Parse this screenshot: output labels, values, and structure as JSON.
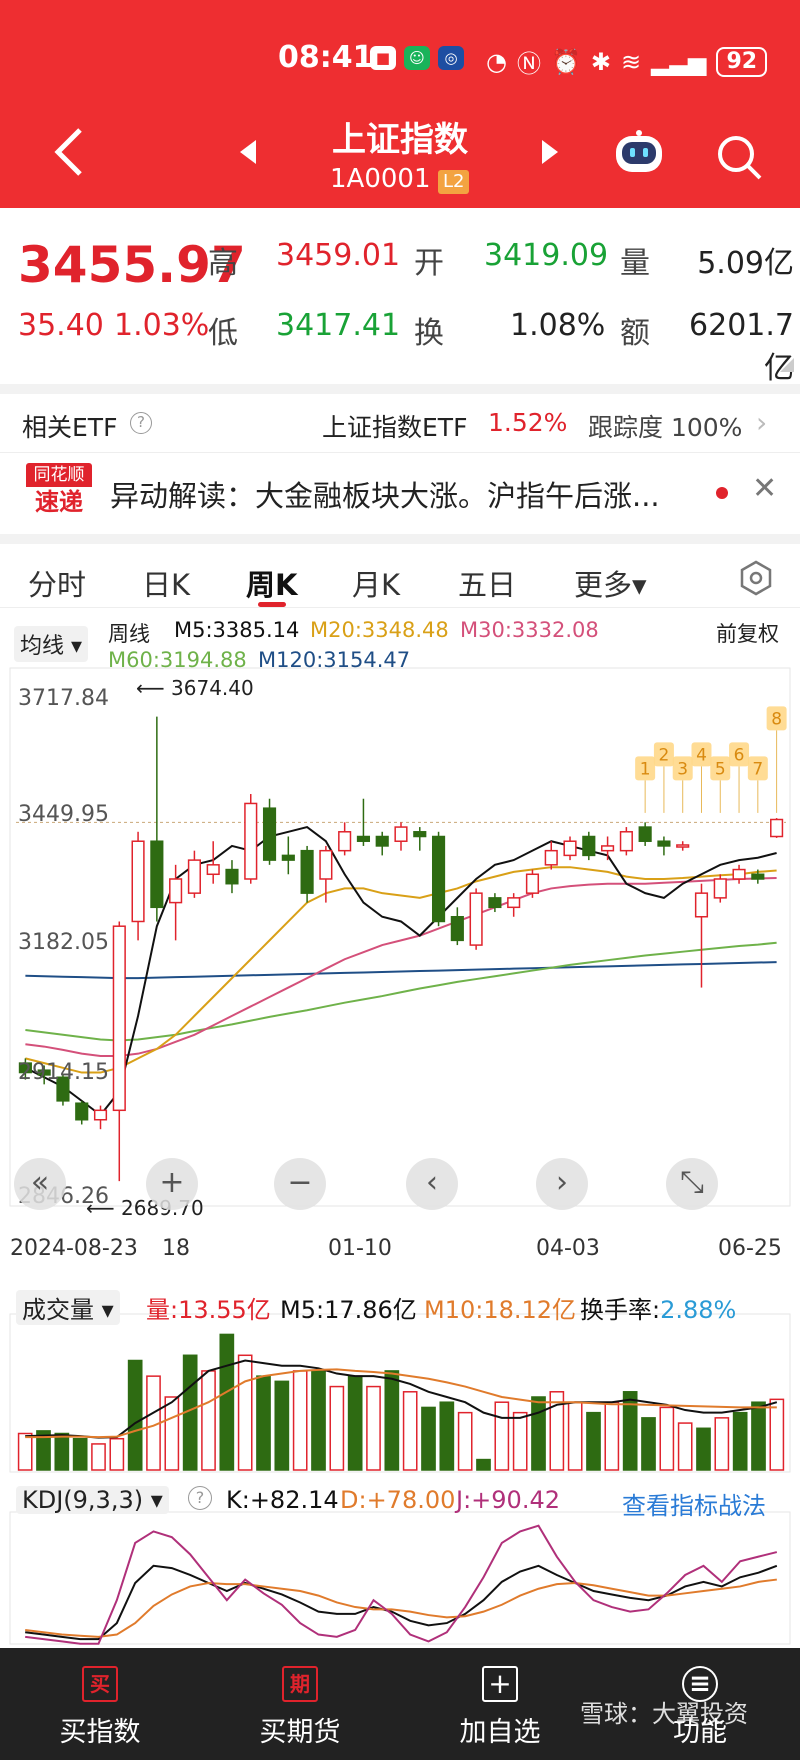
{
  "status_bar": {
    "time": "08:41",
    "battery": "92"
  },
  "header": {
    "title": "上证指数",
    "code": "1A0001",
    "level_badge": "L2"
  },
  "quote": {
    "price": "3455.97",
    "change": "35.40",
    "change_pct": "1.03%",
    "high_label": "高",
    "high": "3459.01",
    "open_label": "开",
    "open": "3419.09",
    "volume_label": "量",
    "volume": "5.09亿",
    "low_label": "低",
    "low": "3417.41",
    "turnover_label": "换",
    "turnover": "1.08%",
    "amount_label": "额",
    "amount": "6201.7亿"
  },
  "etf": {
    "label": "相关ETF",
    "name": "上证指数ETF",
    "pct": "1.52%",
    "track": "跟踪度 100%"
  },
  "news": {
    "logo_top": "同花顺",
    "logo_bottom": "速递",
    "text": "异动解读：大金融板块大涨。沪指午后涨..."
  },
  "tabs": [
    {
      "label": "分时"
    },
    {
      "label": "日K"
    },
    {
      "label": "周K"
    },
    {
      "label": "月K"
    },
    {
      "label": "五日"
    },
    {
      "label": "更多▾"
    }
  ],
  "ma_legend": {
    "chip": "均线 ▾",
    "period": "周线",
    "adjust": "前复权",
    "m5": "M5:3385.14",
    "m20": "M20:3348.48",
    "m30": "M30:3332.08",
    "m60": "M60:3194.88",
    "m120": "M120:3154.47"
  },
  "colors": {
    "up": "#e0232c",
    "down": "#2e6b12",
    "m5": "#111111",
    "m20": "#d9a017",
    "m30": "#d4507a",
    "m60": "#6fb24a",
    "m120": "#1f4e86",
    "accent": "#ee2e31"
  },
  "chart_data": [
    {
      "type": "candlestick",
      "title": "周K",
      "ylim": [
        2846.26,
        3717.84
      ],
      "y_ticks": [
        "3717.84",
        "3449.95",
        "3182.05",
        "2914.15",
        "2846.26"
      ],
      "x_labels": [
        "2024-08-23",
        "18",
        "01-10",
        "04-03",
        "06-25"
      ],
      "annotations": {
        "high": "3674.40",
        "low": "2689.70"
      },
      "series": [
        {
          "name": "M5",
          "values": [
            2930,
            2910,
            2890,
            2860,
            2830,
            2880,
            3040,
            3230,
            3330,
            3360,
            3370,
            3400,
            3390,
            3420,
            3430,
            3440,
            3410,
            3340,
            3280,
            3250,
            3240,
            3210,
            3250,
            3290,
            3330,
            3360,
            3370,
            3390,
            3410,
            3400,
            3390,
            3380,
            3320,
            3300,
            3290,
            3320,
            3340,
            3360,
            3370,
            3375,
            3385
          ]
        },
        {
          "name": "M20",
          "values": [
            2950,
            2940,
            2930,
            2920,
            2920,
            2930,
            2950,
            2970,
            3000,
            3040,
            3080,
            3120,
            3160,
            3200,
            3240,
            3280,
            3300,
            3310,
            3310,
            3300,
            3295,
            3290,
            3300,
            3310,
            3325,
            3335,
            3345,
            3350,
            3355,
            3355,
            3350,
            3345,
            3335,
            3330,
            3330,
            3332,
            3335,
            3338,
            3340,
            3345,
            3348
          ]
        },
        {
          "name": "M30",
          "values": [
            2980,
            2975,
            2968,
            2960,
            2955,
            2955,
            2960,
            2970,
            2985,
            3000,
            3020,
            3040,
            3060,
            3080,
            3100,
            3120,
            3140,
            3160,
            3175,
            3190,
            3200,
            3210,
            3225,
            3240,
            3255,
            3270,
            3285,
            3300,
            3310,
            3315,
            3318,
            3320,
            3320,
            3320,
            3322,
            3324,
            3326,
            3328,
            3330,
            3331,
            3332
          ]
        },
        {
          "name": "M60",
          "values": [
            3010,
            3005,
            3000,
            2995,
            2990,
            2988,
            2990,
            2995,
            3000,
            3008,
            3015,
            3022,
            3030,
            3038,
            3045,
            3052,
            3060,
            3068,
            3075,
            3082,
            3090,
            3098,
            3105,
            3112,
            3118,
            3124,
            3130,
            3136,
            3142,
            3148,
            3153,
            3158,
            3163,
            3168,
            3172,
            3176,
            3180,
            3184,
            3188,
            3191,
            3195
          ]
        },
        {
          "name": "M120",
          "values": [
            3125,
            3124,
            3123,
            3122,
            3121,
            3120,
            3120,
            3121,
            3122,
            3123,
            3124,
            3125,
            3126,
            3127,
            3128,
            3129,
            3130,
            3131,
            3132,
            3133,
            3134,
            3135,
            3136,
            3137,
            3138,
            3139,
            3140,
            3141,
            3142,
            3143,
            3144,
            3145,
            3146,
            3147,
            3148,
            3149,
            3150,
            3151,
            3152,
            3153,
            3154
          ]
        }
      ],
      "candles": [
        {
          "o": 2940,
          "c": 2920,
          "h": 2950,
          "l": 2905
        },
        {
          "o": 2925,
          "c": 2915,
          "h": 2935,
          "l": 2895
        },
        {
          "o": 2910,
          "c": 2860,
          "h": 2915,
          "l": 2850
        },
        {
          "o": 2855,
          "c": 2820,
          "h": 2860,
          "l": 2810
        },
        {
          "o": 2820,
          "c": 2840,
          "h": 2850,
          "l": 2800
        },
        {
          "o": 2840,
          "c": 3230,
          "h": 3240,
          "l": 2690
        },
        {
          "o": 3240,
          "c": 3410,
          "h": 3430,
          "l": 3200
        },
        {
          "o": 3410,
          "c": 3270,
          "h": 3674,
          "l": 3240
        },
        {
          "o": 3280,
          "c": 3330,
          "h": 3360,
          "l": 3200
        },
        {
          "o": 3300,
          "c": 3370,
          "h": 3390,
          "l": 3290
        },
        {
          "o": 3340,
          "c": 3360,
          "h": 3410,
          "l": 3320
        },
        {
          "o": 3350,
          "c": 3320,
          "h": 3370,
          "l": 3300
        },
        {
          "o": 3330,
          "c": 3490,
          "h": 3510,
          "l": 3320
        },
        {
          "o": 3480,
          "c": 3370,
          "h": 3500,
          "l": 3360
        },
        {
          "o": 3380,
          "c": 3370,
          "h": 3420,
          "l": 3340
        },
        {
          "o": 3390,
          "c": 3300,
          "h": 3400,
          "l": 3280
        },
        {
          "o": 3330,
          "c": 3390,
          "h": 3400,
          "l": 3280
        },
        {
          "o": 3390,
          "c": 3430,
          "h": 3450,
          "l": 3380
        },
        {
          "o": 3420,
          "c": 3410,
          "h": 3500,
          "l": 3400
        },
        {
          "o": 3420,
          "c": 3400,
          "h": 3430,
          "l": 3380
        },
        {
          "o": 3410,
          "c": 3440,
          "h": 3450,
          "l": 3390
        },
        {
          "o": 3430,
          "c": 3420,
          "h": 3440,
          "l": 3390
        },
        {
          "o": 3420,
          "c": 3240,
          "h": 3430,
          "l": 3230
        },
        {
          "o": 3250,
          "c": 3200,
          "h": 3270,
          "l": 3190
        },
        {
          "o": 3190,
          "c": 3300,
          "h": 3310,
          "l": 3180
        },
        {
          "o": 3290,
          "c": 3270,
          "h": 3300,
          "l": 3260
        },
        {
          "o": 3270,
          "c": 3290,
          "h": 3300,
          "l": 3250
        },
        {
          "o": 3300,
          "c": 3340,
          "h": 3350,
          "l": 3290
        },
        {
          "o": 3360,
          "c": 3390,
          "h": 3410,
          "l": 3350
        },
        {
          "o": 3380,
          "c": 3410,
          "h": 3420,
          "l": 3370
        },
        {
          "o": 3420,
          "c": 3380,
          "h": 3430,
          "l": 3370
        },
        {
          "o": 3390,
          "c": 3400,
          "h": 3420,
          "l": 3370
        },
        {
          "o": 3390,
          "c": 3430,
          "h": 3440,
          "l": 3380
        },
        {
          "o": 3440,
          "c": 3410,
          "h": 3450,
          "l": 3400
        },
        {
          "o": 3410,
          "c": 3400,
          "h": 3420,
          "l": 3380
        },
        {
          "o": 3400,
          "c": 3402,
          "h": 3410,
          "l": 3390
        },
        {
          "o": 3250,
          "c": 3300,
          "h": 3320,
          "l": 3100
        },
        {
          "o": 3290,
          "c": 3330,
          "h": 3340,
          "l": 3280
        },
        {
          "o": 3330,
          "c": 3350,
          "h": 3360,
          "l": 3320
        },
        {
          "o": 3340,
          "c": 3330,
          "h": 3350,
          "l": 3320
        },
        {
          "o": 3420,
          "c": 3456,
          "h": 3459,
          "l": 3417
        }
      ],
      "markers": [
        "1",
        "2",
        "3",
        "4",
        "5",
        "6",
        "7",
        "8"
      ]
    },
    {
      "type": "bar",
      "title": "成交量",
      "legend": {
        "vol": "量:13.55亿",
        "m5": "M5:17.86亿",
        "m10": "M10:18.12亿",
        "turnover_label": "换手率:",
        "turnover": "2.88%"
      },
      "values": [
        7,
        7.5,
        7,
        6,
        5,
        6,
        21,
        18,
        14,
        22,
        19,
        26,
        22,
        18,
        17,
        19,
        19,
        16,
        18,
        16,
        19,
        15,
        12,
        13,
        11,
        2,
        13,
        11,
        14,
        15,
        13,
        11,
        13,
        15,
        10,
        12,
        9,
        8,
        10,
        11,
        13,
        13.55
      ],
      "up": [
        true,
        false,
        false,
        false,
        true,
        true,
        false,
        true,
        true,
        false,
        true,
        false,
        true,
        false,
        false,
        true,
        false,
        true,
        false,
        true,
        false,
        true,
        false,
        false,
        true,
        false,
        true,
        true,
        false,
        true,
        true,
        false,
        true,
        false,
        false,
        true,
        true,
        false,
        true,
        false,
        false,
        true
      ],
      "series": [
        {
          "name": "M5",
          "values": [
            6.5,
            6.6,
            6.7,
            6.5,
            6.2,
            6.3,
            9,
            11,
            13,
            16,
            19,
            20,
            21,
            20.5,
            20,
            20,
            19.5,
            18.5,
            18,
            18,
            17.5,
            16.5,
            15,
            14,
            13,
            11,
            10,
            10,
            11,
            12.5,
            13,
            13,
            13,
            13.5,
            13,
            12.5,
            11.5,
            11,
            11,
            11.5,
            12,
            13
          ]
        },
        {
          "name": "M10",
          "values": [
            6.3,
            6.3,
            6.4,
            6.4,
            6.3,
            6.4,
            7.5,
            8.5,
            10,
            11.5,
            13,
            15,
            17,
            18,
            18.5,
            19,
            19.2,
            19.3,
            19,
            18.8,
            18.5,
            18,
            17.5,
            16.8,
            16,
            15,
            14,
            13.5,
            13,
            13,
            13,
            12.8,
            12.6,
            12.6,
            12.5,
            12.4,
            12.3,
            12.2,
            12.1,
            12,
            12,
            12
          ]
        }
      ]
    },
    {
      "type": "line",
      "title": "KDJ(9,3,3)",
      "legend": {
        "k": "K:+82.14",
        "d": "D:+78.00",
        "j": "J:+90.42",
        "link": "查看指标战法"
      },
      "series": [
        {
          "name": "K",
          "values": [
            12,
            10,
            8,
            6,
            6,
            20,
            55,
            70,
            68,
            62,
            55,
            48,
            55,
            50,
            45,
            38,
            30,
            28,
            28,
            34,
            30,
            22,
            18,
            20,
            28,
            40,
            56,
            65,
            70,
            62,
            55,
            48,
            45,
            42,
            40,
            44,
            52,
            56,
            52,
            60,
            64,
            70
          ]
        },
        {
          "name": "D",
          "values": [
            14,
            12,
            10,
            9,
            8,
            10,
            20,
            35,
            45,
            52,
            55,
            54,
            54,
            52,
            50,
            48,
            44,
            38,
            34,
            32,
            32,
            30,
            27,
            25,
            26,
            30,
            36,
            44,
            50,
            54,
            55,
            53,
            50,
            47,
            44,
            44,
            46,
            48,
            50,
            52,
            56,
            58
          ]
        },
        {
          "name": "J",
          "values": [
            8,
            6,
            4,
            2,
            2,
            40,
            90,
            100,
            95,
            80,
            60,
            40,
            58,
            46,
            36,
            20,
            10,
            8,
            14,
            40,
            28,
            10,
            4,
            12,
            34,
            60,
            90,
            100,
            105,
            78,
            56,
            40,
            34,
            30,
            32,
            46,
            62,
            70,
            56,
            74,
            78,
            82
          ]
        }
      ]
    }
  ],
  "controls": [
    "«",
    "+",
    "−",
    "‹",
    "›",
    "⤡"
  ],
  "bottom_nav": [
    {
      "icon": "买",
      "label": "买指数"
    },
    {
      "icon": "期",
      "label": "买期货"
    },
    {
      "icon": "+",
      "label": "加自选"
    },
    {
      "icon": "≡",
      "label": "功能"
    }
  ],
  "watermark": "雪球：大翼投资"
}
